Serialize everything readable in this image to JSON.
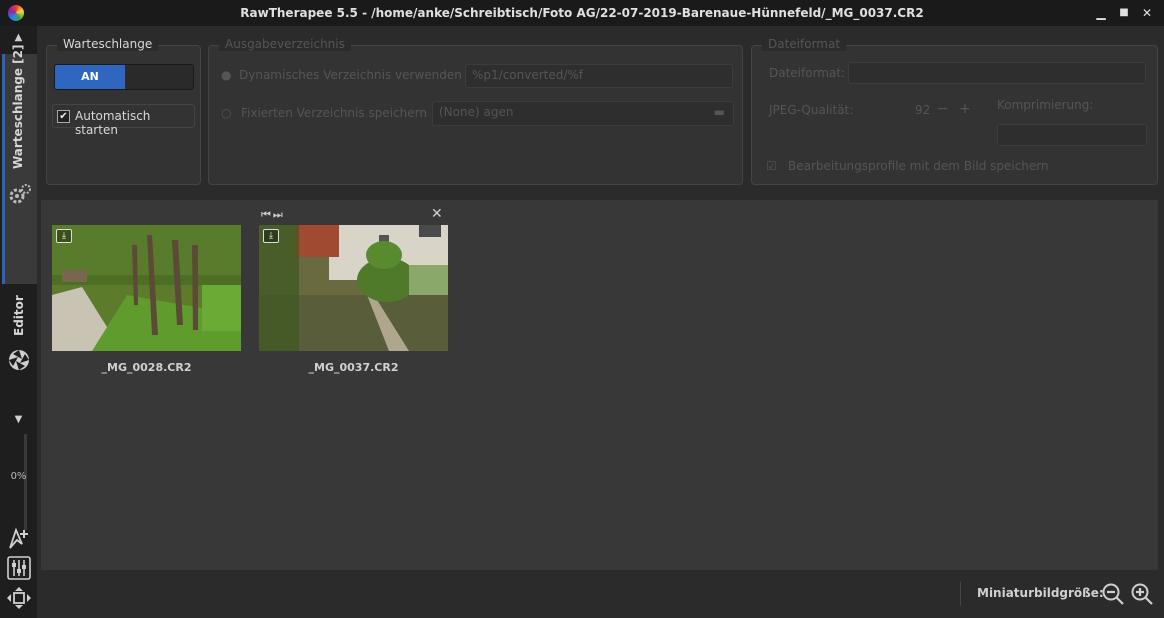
{
  "window": {
    "title": "RawTherapee 5.5 - /home/anke/Schreibtisch/Foto AG/22-07-2019-Barenaue-Hünnefeld/_MG_0037.CR2",
    "minimize": "▁",
    "maximize": "■",
    "close": "✕"
  },
  "sidebar": {
    "tab_queue_label": "Warteschlange [2]",
    "tab_editor_label": "Editor",
    "progress_label": "0%",
    "progress_value": 0,
    "up_arrow": "▲",
    "down_arrow": "▼",
    "icons": [
      "gears-icon",
      "aperture-icon",
      "cursor-plus-icon",
      "sliders-icon",
      "move-icon"
    ]
  },
  "queue_panel": {
    "title": "Warteschlange",
    "toggle_on_label": "AN",
    "autostart_checked": true,
    "autostart_label": "Automatisch starten"
  },
  "output_panel": {
    "title": "Ausgabeverzeichnis",
    "dynamic_option_label": "Dynamisches Verzeichnis verwenden",
    "dynamic_template": "%p1/converted/%f",
    "fixed_option_label": "Fixierten Verzeichnis speichern",
    "fixed_folder": "(None) agen"
  },
  "format_panel": {
    "title": "Dateiformat",
    "format_label": "Dateiformat:",
    "jpeg_quality_label": "JPEG-Qualität:",
    "jpeg_quality_value": "92",
    "compression_label": "Komprimierung:",
    "save_profile_label": "Bearbeitungsprofile mit dem Bild speichern"
  },
  "queue_items": [
    {
      "filename": "_MG_0028.CR2"
    },
    {
      "filename": "_MG_0037.CR2"
    }
  ],
  "main_controls": {
    "prev_next": "⏮⏭",
    "remove": "✕"
  },
  "bottom_bar": {
    "thumb_size_label": "Miniaturbildgröße:"
  },
  "colors": {
    "accent": "#2e66c0",
    "window_bg": "#2b2b2b",
    "panel_bg": "#383838",
    "titlebar": "#1a1a1a"
  }
}
